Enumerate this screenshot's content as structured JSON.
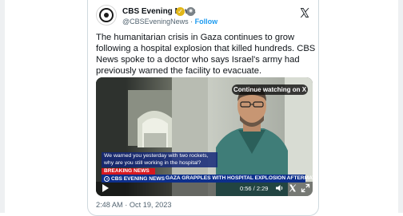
{
  "tweet": {
    "author_name": "CBS Evening News",
    "handle": "@CBSEveningNews",
    "separator": " · ",
    "follow_label": "Follow",
    "avatar_text": "CBS\nEVENING\nNEWS",
    "text": "The humanitarian crisis in Gaza continues to grow\nfollowing a hospital explosion that killed hundreds. CBS\nNews spoke to a doctor who says Israel's army had\npreviously warned the facility to evacuate.",
    "timestamp": "2:48 AM · Oct 19, 2023"
  },
  "video": {
    "continue_label": "Continue watching on X",
    "caption_line1": "We warned you yesterday with two rockets,",
    "caption_line2": "why are you still working in the hospital?",
    "breaking_label": "BREAKING NEWS",
    "logo_text": "CBS EVENING NEWS",
    "headline": "GAZA GRAPPLES WITH HOSPITAL EXPLOSION AFTERMATH",
    "time_display": "0:56 / 2:29",
    "progress": 0.376
  },
  "icons": {
    "verified": "gold-check-badge-icon",
    "affiliate": "government-badge-icon",
    "logo": "x-logo-icon",
    "play": "play-icon",
    "volume": "volume-icon",
    "x_mark": "x-mark-icon",
    "fullscreen": "fullscreen-icon"
  },
  "colors": {
    "link": "#1d9bf0",
    "verified_gold": "#e2b719",
    "breaking_red": "#d71920",
    "lower_third_blue": "#0d2f8c",
    "muted_text": "#536471"
  }
}
